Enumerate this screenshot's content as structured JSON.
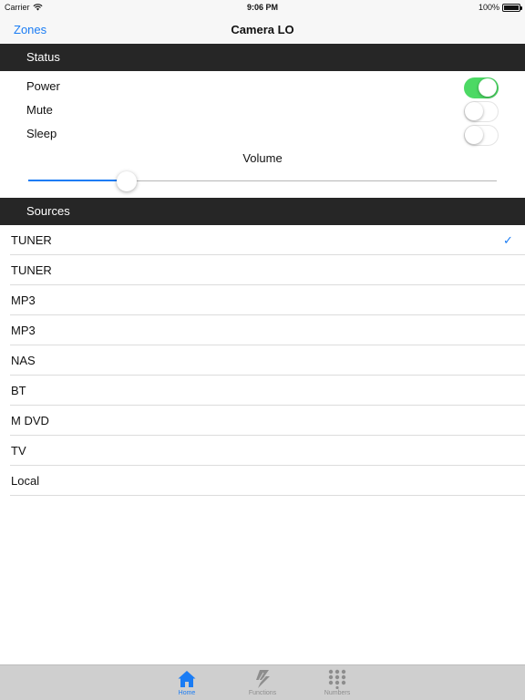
{
  "status_bar": {
    "carrier": "Carrier",
    "time": "9:06 PM",
    "battery": "100%",
    "battery_level": 1.0
  },
  "nav": {
    "back_label": "Zones",
    "title": "Camera LO"
  },
  "status_section": {
    "header": "Status",
    "power": {
      "label": "Power",
      "on": true
    },
    "mute": {
      "label": "Mute",
      "on": false
    },
    "sleep": {
      "label": "Sleep",
      "on": false
    },
    "volume": {
      "label": "Volume",
      "value": 0.21
    }
  },
  "sources_section": {
    "header": "Sources",
    "items": [
      {
        "label": "TUNER",
        "selected": true
      },
      {
        "label": "TUNER",
        "selected": false
      },
      {
        "label": "MP3",
        "selected": false
      },
      {
        "label": "MP3",
        "selected": false
      },
      {
        "label": "NAS",
        "selected": false
      },
      {
        "label": "BT",
        "selected": false
      },
      {
        "label": "M DVD",
        "selected": false
      },
      {
        "label": "TV",
        "selected": false
      },
      {
        "label": "Local",
        "selected": false
      }
    ],
    "checkmark": "✓"
  },
  "tab_bar": {
    "tabs": [
      {
        "label": "Home",
        "icon": "home-icon",
        "active": true
      },
      {
        "label": "Functions",
        "icon": "lightning-icon",
        "active": false
      },
      {
        "label": "Numbers",
        "icon": "grid-icon",
        "active": false
      }
    ]
  },
  "colors": {
    "accent": "#1a7cf4",
    "toggle_on": "#4cd964",
    "section_header_bg": "#262626",
    "tab_bar_bg": "#cfcfcf"
  }
}
